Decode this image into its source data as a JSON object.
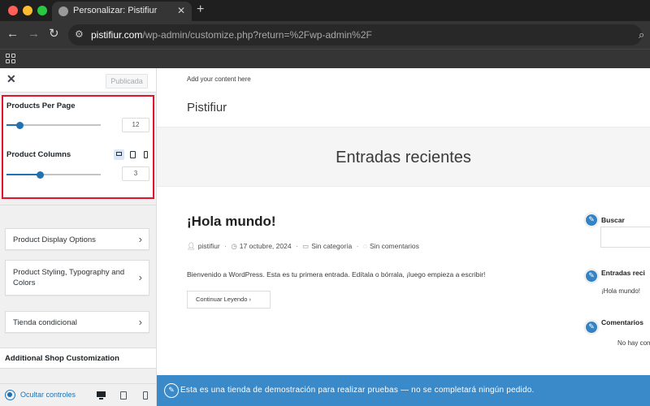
{
  "browser": {
    "tab_title": "Personalizar: Pistifiur",
    "url_host": "pistifiur.com",
    "url_path": "/wp-admin/customize.php?return=%2Fwp-admin%2F",
    "icons": {
      "close": "close-icon",
      "new_tab": "plus-icon",
      "back": "arrow-left-icon",
      "forward": "arrow-right-icon",
      "reload": "reload-icon",
      "site_settings": "tune-icon",
      "zoom": "zoom-icon",
      "apps": "apps-grid-icon"
    }
  },
  "sidebar": {
    "published_label": "Publicada",
    "products_per_page": {
      "label": "Products Per Page",
      "value": "12",
      "slider_fraction": 0.14
    },
    "product_columns": {
      "label": "Product Columns",
      "value": "3",
      "slider_fraction": 0.35
    },
    "sections": [
      {
        "label": "Product Display Options"
      },
      {
        "label": "Product Styling, Typography and Colors"
      },
      {
        "label": "Tienda condicional"
      }
    ],
    "additional_header": "Additional Shop Customization",
    "footer": {
      "hide_label": "Ocultar controles"
    },
    "highlight_color": "#e0142c",
    "accent_color": "#2271b1"
  },
  "preview": {
    "top_text": "Add your content here",
    "site_title": "Pistifiur",
    "band_title": "Entradas recientes",
    "post": {
      "title": "¡Hola mundo!",
      "author": "pistifiur",
      "date": "17 octubre, 2024",
      "category": "Sin categoría",
      "comments": "Sin comentarios",
      "excerpt": "Bienvenido a WordPress. Esta es tu primera entrada. Edítala o bórrala, ¡luego empieza a escribir!",
      "read_more": "Continuar Leyendo"
    },
    "widgets": {
      "search_title": "Buscar",
      "recent_title": "Entradas reci",
      "recent_item": "¡Hola mundo!",
      "comments_title": "Comentarios",
      "comments_item": "No hay com"
    },
    "notice": "Esta es una tienda de demostración para realizar pruebas — no se completará ningún pedido.",
    "notice_color": "#3a89c9"
  }
}
